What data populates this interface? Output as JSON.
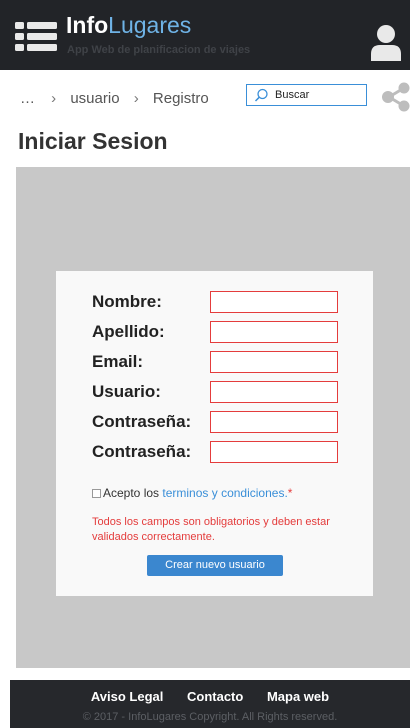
{
  "header": {
    "brand_bold": "Info",
    "brand_light": "Lugares",
    "tagline": "App Web de planificacion de viajes"
  },
  "breadcrumb": {
    "ellipsis": "…",
    "separator": "›",
    "items": [
      "usuario",
      "Registro"
    ]
  },
  "search": {
    "placeholder": "Buscar"
  },
  "page": {
    "title": "Iniciar Sesion"
  },
  "form": {
    "fields": [
      {
        "label": "Nombre:",
        "value": ""
      },
      {
        "label": "Apellido:",
        "value": ""
      },
      {
        "label": "Email:",
        "value": ""
      },
      {
        "label": "Usuario:",
        "value": ""
      },
      {
        "label": "Contraseña:",
        "value": ""
      },
      {
        "label": "Contraseña:",
        "value": ""
      }
    ],
    "terms_prefix": "Acepto los",
    "terms_link": "terminos y condiciones.",
    "terms_required": "*",
    "terms_checked": false,
    "validation_message": "Todos los campos son obligatorios y deben estar validados correctamente.",
    "submit_label": "Crear nuevo usuario"
  },
  "footer": {
    "links": [
      "Aviso Legal",
      "Contacto",
      "Mapa web"
    ],
    "copyright": "© 2017 - InfoLugares Copyright. All Rights reserved."
  },
  "colors": {
    "header_bg": "#222428",
    "accent_blue": "#3b87cf",
    "brand_light": "#6fb3e6",
    "error_red": "#e43c3c",
    "gray_area": "#c8c8c8"
  },
  "icons": {
    "menu": "menu-list-icon",
    "user": "user-icon",
    "search": "search-icon",
    "share": "share-icon"
  }
}
